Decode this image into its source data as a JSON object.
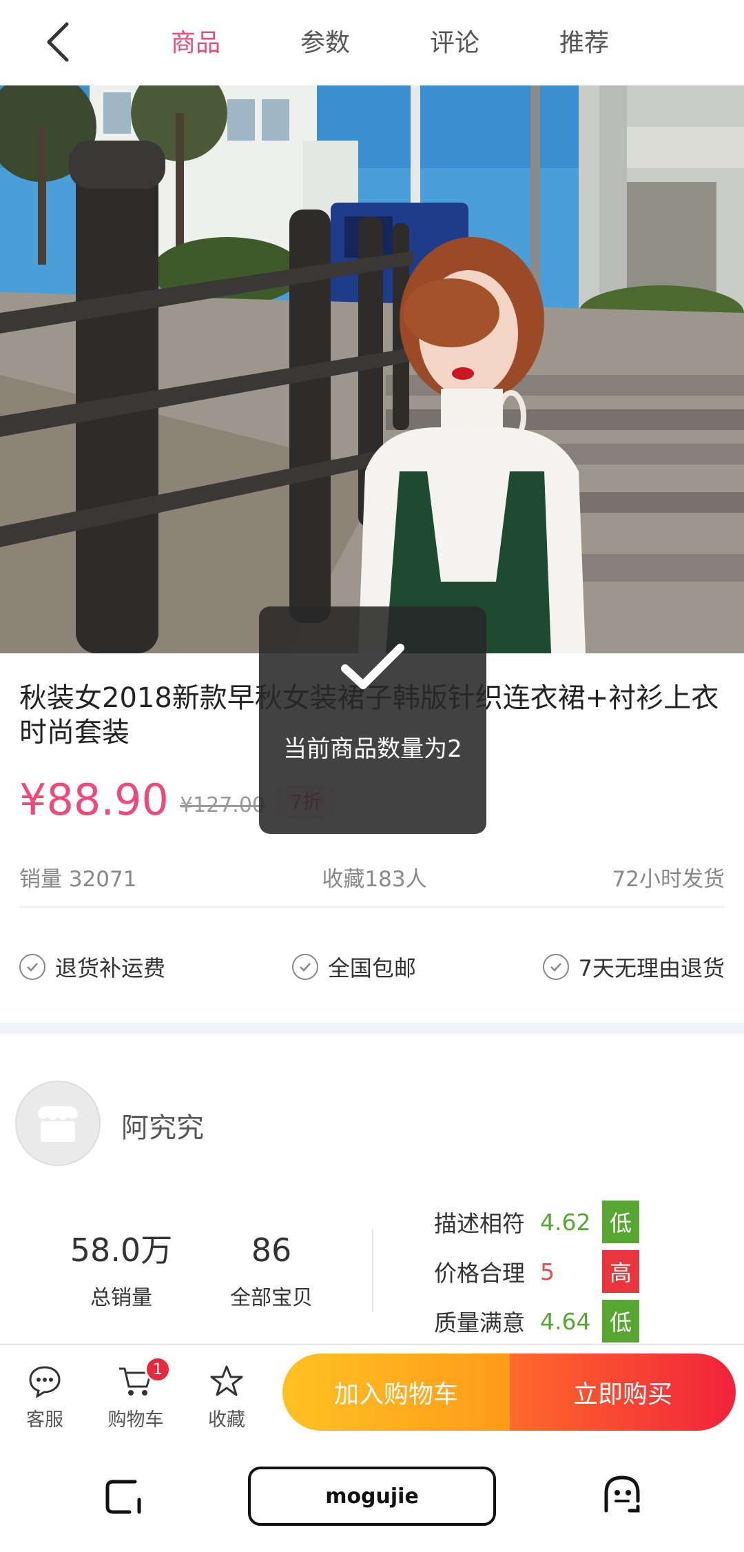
{
  "header": {
    "tabs": [
      {
        "label": "商品",
        "active": true
      },
      {
        "label": "参数",
        "active": false
      },
      {
        "label": "评论",
        "active": false
      },
      {
        "label": "推荐",
        "active": false
      }
    ]
  },
  "product": {
    "title": "秋装女2018新款早秋女装裙子韩版针织连衣裙+衬衫上衣时尚套装",
    "price": "¥88.90",
    "original_price": "¥127.00",
    "discount": "7折",
    "sales": "销量 32071",
    "favorites": "收藏183人",
    "shipping_time": "72小时发货",
    "services": [
      "退货补运费",
      "全国包邮",
      "7天无理由退货"
    ]
  },
  "toast": {
    "message": "当前商品数量为2"
  },
  "shop": {
    "name": "阿究究",
    "total_sales_value": "58.0万",
    "total_sales_label": "总销量",
    "items_value": "86",
    "items_label": "全部宝贝",
    "ratings": [
      {
        "label": "描述相符",
        "score": "4.62",
        "level": "低"
      },
      {
        "label": "价格合理",
        "score": "5",
        "level": "高"
      },
      {
        "label": "质量满意",
        "score": "4.64",
        "level": "低"
      }
    ]
  },
  "actionbar": {
    "service_label": "客服",
    "cart_label": "购物车",
    "cart_count": "1",
    "favorite_label": "收藏",
    "add_to_cart": "加入购物车",
    "buy_now": "立即购买"
  },
  "system_nav": {
    "center_label": "mogujie"
  },
  "colors": {
    "accent": "#ee4a77",
    "rating_green": "#58a632",
    "rating_red": "#e8363c"
  }
}
